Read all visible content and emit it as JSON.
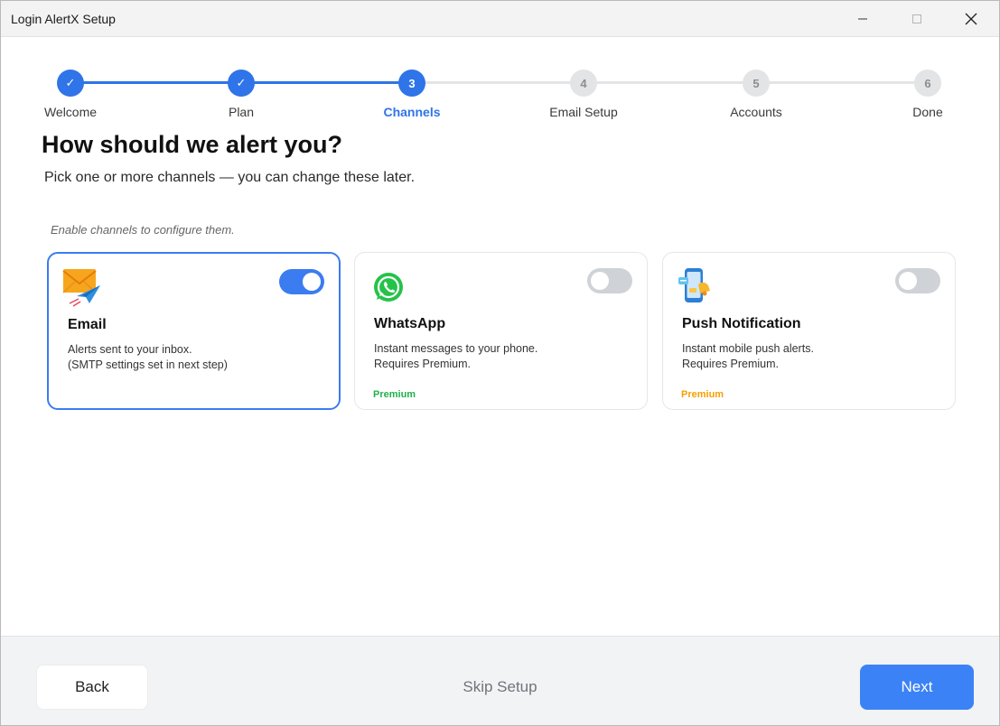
{
  "window": {
    "title": "Login AlertX Setup",
    "controls": [
      "minimize-icon",
      "maximize-icon",
      "close-icon"
    ]
  },
  "stepper": {
    "steps": [
      {
        "number": "1",
        "label": "Welcome",
        "state": "done"
      },
      {
        "number": "2",
        "label": "Plan",
        "state": "done"
      },
      {
        "number": "3",
        "label": "Channels",
        "state": "active"
      },
      {
        "number": "4",
        "label": "Email Setup",
        "state": "pending"
      },
      {
        "number": "5",
        "label": "Accounts",
        "state": "pending"
      },
      {
        "number": "6",
        "label": "Done",
        "state": "pending"
      }
    ],
    "done_glyph": "✓"
  },
  "main": {
    "title": "How should we alert you?",
    "subtitle": "Pick one or more channels — you can change these later.",
    "hint": "Enable channels to configure them."
  },
  "channels": [
    {
      "name": "Email",
      "icon": "email-icon",
      "desc_line1": "Alerts sent to your inbox.",
      "desc_line2": "(SMTP settings set in next step)",
      "enabled": true,
      "badge": ""
    },
    {
      "name": "WhatsApp",
      "icon": "whatsapp-icon",
      "desc_line1": "Instant messages to your phone.",
      "desc_line2": "Requires Premium.",
      "enabled": false,
      "badge": "Premium",
      "badge_color": "#22b04a"
    },
    {
      "name": "Push Notification",
      "icon": "push-notification-icon",
      "desc_line1": "Instant mobile push alerts.",
      "desc_line2": "Requires Premium.",
      "enabled": false,
      "badge": "Premium",
      "badge_color": "#f5a000"
    }
  ],
  "footer": {
    "back_label": "Back",
    "skip_label": "Skip Setup",
    "next_label": "Next"
  },
  "colors": {
    "accent": "#2f74e8",
    "next_button": "#3b82f6",
    "pending_step": "#e3e4e6"
  }
}
